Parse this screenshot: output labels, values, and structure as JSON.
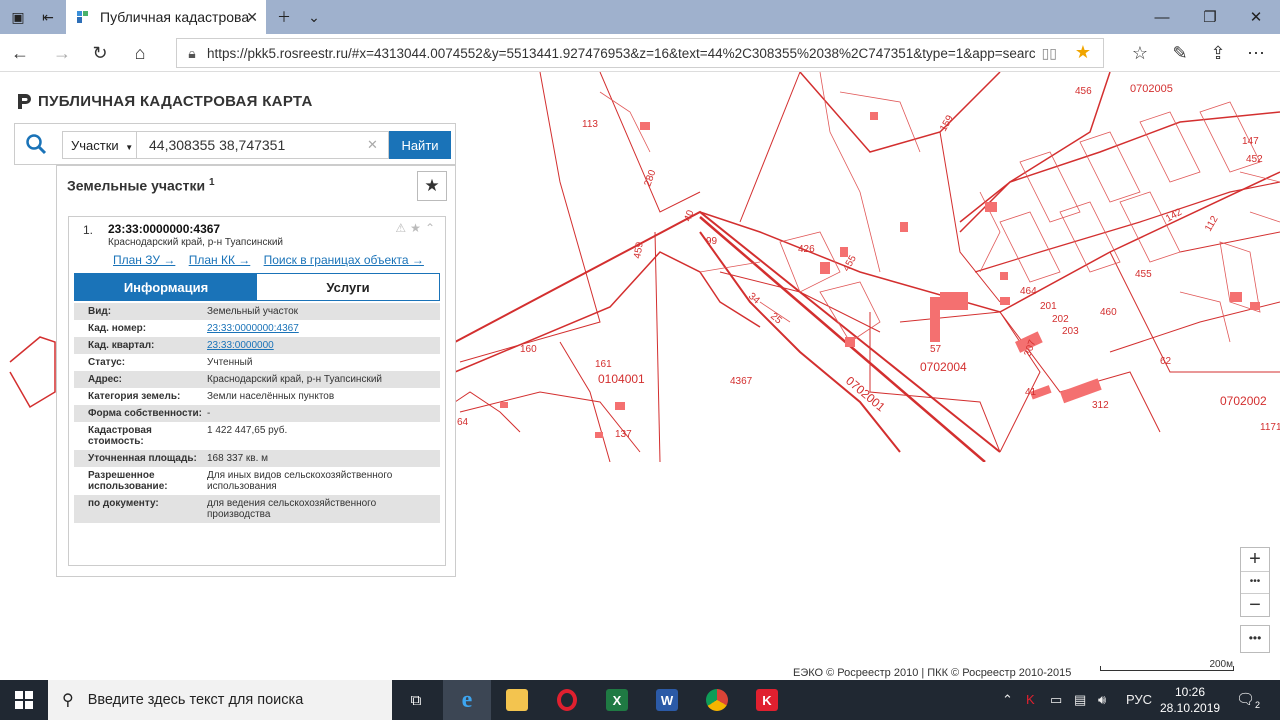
{
  "browser": {
    "tab_title": "Публичная кадастрова",
    "url": "https://pkk5.rosreestr.ru/#x=4313044.0074552&y=5513441.927476953&z=16&text=44%2C308355%2038%2C747351&type=1&app=search&c"
  },
  "brand": {
    "title": "ПУБЛИЧНАЯ КАДАСТРОВАЯ КАРТА"
  },
  "search": {
    "type_label": "Участки",
    "query": "44,308355 38,747351",
    "button": "Найти"
  },
  "panel": {
    "title": "Земельные участки",
    "count": "1",
    "result": {
      "index": "1.",
      "cad_number": "23:33:0000000:4367",
      "location": "Краснодарский край, р-н Туапсинский",
      "links": [
        "План ЗУ →",
        "План КК →",
        "Поиск в границах объекта →"
      ],
      "tab_info": "Информация",
      "tab_services": "Услуги",
      "fields": [
        {
          "k": "Вид:",
          "v": "Земельный участок"
        },
        {
          "k": "Кад. номер:",
          "v": "23:33:0000000:4367"
        },
        {
          "k": "Кад. квартал:",
          "v": "23:33:0000000"
        },
        {
          "k": "Статус:",
          "v": "Учтенный"
        },
        {
          "k": "Адрес:",
          "v": "Краснодарский край, р-н Туапсинский"
        },
        {
          "k": "Категория земель:",
          "v": "Земли населённых пунктов"
        },
        {
          "k": "Форма собственности:",
          "v": "-"
        },
        {
          "k": "Кадастровая стоимость:",
          "v": "1 422 447,65 руб."
        },
        {
          "k": "Уточненная площадь:",
          "v": "168 337 кв. м"
        },
        {
          "k": "Разрешенное использование:",
          "v": "Для иных видов сельскохозяйственного использования"
        },
        {
          "k": "по документу:",
          "v": "для ведения сельскохозяйственного производства"
        }
      ]
    }
  },
  "map": {
    "copyright": "ЕЭКО © Росреестр 2010 | ПКК © Росреестр 2010-2015",
    "scale": "200м",
    "labels": [
      "0702005",
      "456",
      "113",
      "280",
      "159",
      "459",
      "40",
      "99",
      "34",
      "25",
      "160",
      "161",
      "0104001",
      "4367",
      "0702001",
      "57",
      "0702004",
      "464",
      "201",
      "202",
      "203",
      "460",
      "455",
      "62",
      "0702002",
      "307",
      "41",
      "312",
      "137",
      "64",
      "1171",
      "426",
      "455",
      "147",
      "452",
      "142",
      "112"
    ]
  },
  "taskbar": {
    "search_placeholder": "Введите здесь текст для поиска",
    "lang": "РУС",
    "time": "10:26",
    "date": "28.10.2019",
    "notifications": "2"
  },
  "colors": {
    "accent": "#1a73b8",
    "map_line": "#d32f2f",
    "map_fill": "#f26d6d"
  }
}
